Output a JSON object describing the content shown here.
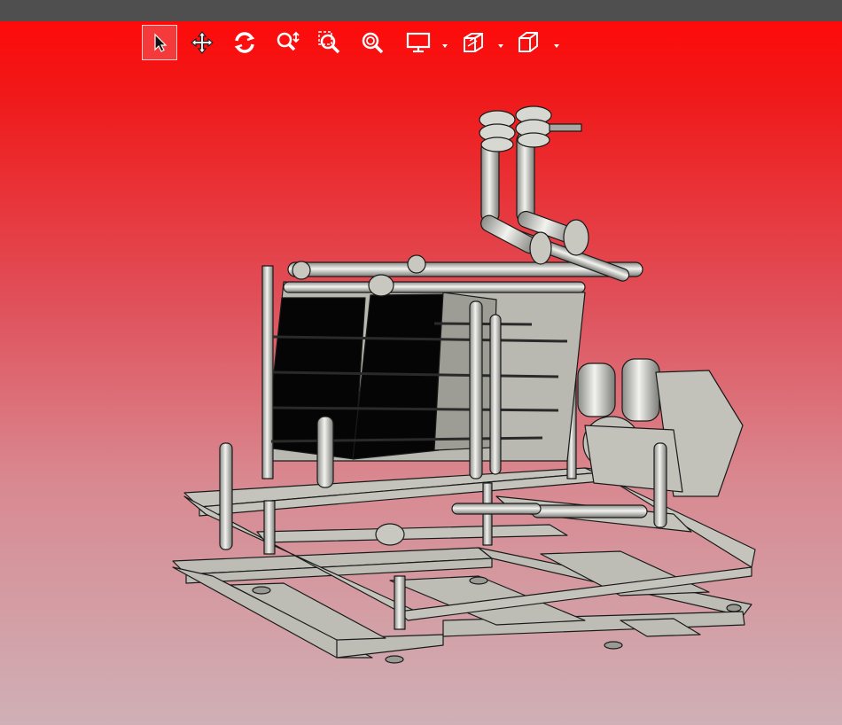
{
  "window": {
    "title": ""
  },
  "toolbar": {
    "buttons": [
      {
        "name": "select-tool-button",
        "icon": "cursor-arrow-icon",
        "active": true
      },
      {
        "name": "pan-tool-button",
        "icon": "move-arrows-icon",
        "active": false
      },
      {
        "name": "rotate-tool-button",
        "icon": "rotate-icon",
        "active": false
      },
      {
        "name": "zoom-tool-button",
        "icon": "zoom-updown-icon",
        "active": false
      },
      {
        "name": "zoom-window-button",
        "icon": "zoom-window-icon",
        "active": false
      },
      {
        "name": "zoom-fit-button",
        "icon": "zoom-fit-icon",
        "active": false
      },
      {
        "name": "display-mode-button",
        "icon": "monitor-icon",
        "has_dropdown": true
      },
      {
        "name": "section-view-button",
        "icon": "section-cube-icon",
        "has_dropdown": true
      },
      {
        "name": "standard-views-button",
        "icon": "cube-icon",
        "has_dropdown": true
      }
    ]
  },
  "viewport": {
    "background_top": "#ff0a0a",
    "background_bottom": "#cfb0b6",
    "model_color": "#c9c9c3",
    "plate_color": "#050505",
    "edge_color": "#1a1a1a"
  }
}
